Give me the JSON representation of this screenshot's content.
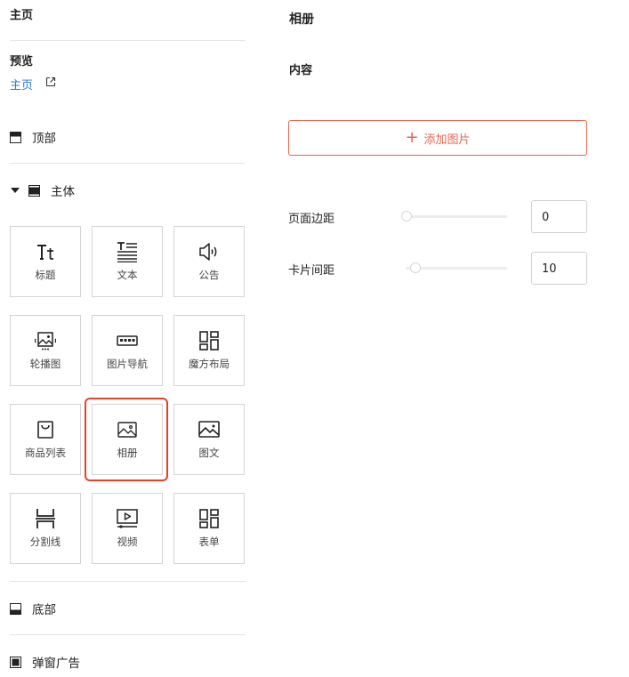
{
  "left_panel": {
    "home_title": "主页",
    "preview_label": "预览",
    "preview_link": "主页",
    "sections": {
      "top": "顶部",
      "body": "主体",
      "bottom": "底部",
      "popup": "弹窗广告"
    },
    "components": [
      {
        "label": "标题",
        "icon": "title-icon"
      },
      {
        "label": "文本",
        "icon": "text-icon"
      },
      {
        "label": "公告",
        "icon": "speaker-icon"
      },
      {
        "label": "轮播图",
        "icon": "carousel-icon"
      },
      {
        "label": "图片导航",
        "icon": "image-nav-icon"
      },
      {
        "label": "魔方布局",
        "icon": "cube-layout-icon"
      },
      {
        "label": "商品列表",
        "icon": "shopping-bag-icon"
      },
      {
        "label": "相册",
        "icon": "album-icon"
      },
      {
        "label": "图文",
        "icon": "image-text-icon"
      },
      {
        "label": "分割线",
        "icon": "divider-icon"
      },
      {
        "label": "视频",
        "icon": "video-icon"
      },
      {
        "label": "表单",
        "icon": "form-icon"
      }
    ],
    "selected_component": "相册",
    "selection_color": "#e0442c",
    "link_color": "#2b7ad1"
  },
  "right_panel": {
    "title": "相册",
    "content_label": "内容",
    "add_image_label": "添加图片",
    "accent_color": "#e0674f",
    "page_margin": {
      "label": "页面边距",
      "value": "0"
    },
    "card_spacing": {
      "label": "卡片间距",
      "value": "10"
    }
  }
}
